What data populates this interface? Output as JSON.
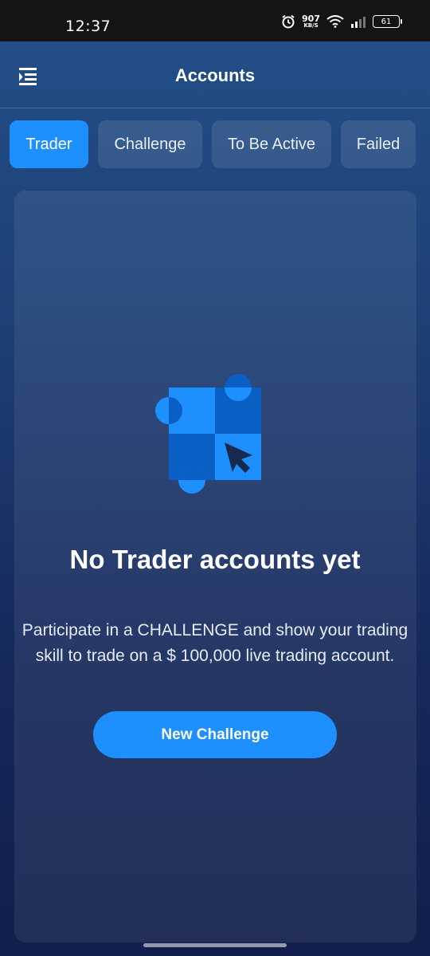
{
  "status_bar": {
    "time": "12:37",
    "net_speed_value": "907",
    "net_speed_unit": "KB/S",
    "battery_level": "61",
    "icons": [
      "alarm-icon",
      "wifi-icon",
      "signal-icon",
      "battery-icon"
    ]
  },
  "header": {
    "title": "Accounts",
    "menu_icon": "menu-icon"
  },
  "tabs": [
    {
      "label": "Trader",
      "active": true
    },
    {
      "label": "Challenge",
      "active": false
    },
    {
      "label": "To Be Active",
      "active": false
    },
    {
      "label": "Failed",
      "active": false
    }
  ],
  "empty_state": {
    "title": "No Trader accounts yet",
    "description": "Participate in a CHALLENGE and show your trading skill to trade on a $ 100,000 live trading account.",
    "button_label": "New Challenge",
    "illustration_icon": "puzzle-cursor-icon"
  },
  "colors": {
    "accent": "#1e8fff",
    "background_top": "#24508a",
    "background_bottom": "#121f4c"
  }
}
